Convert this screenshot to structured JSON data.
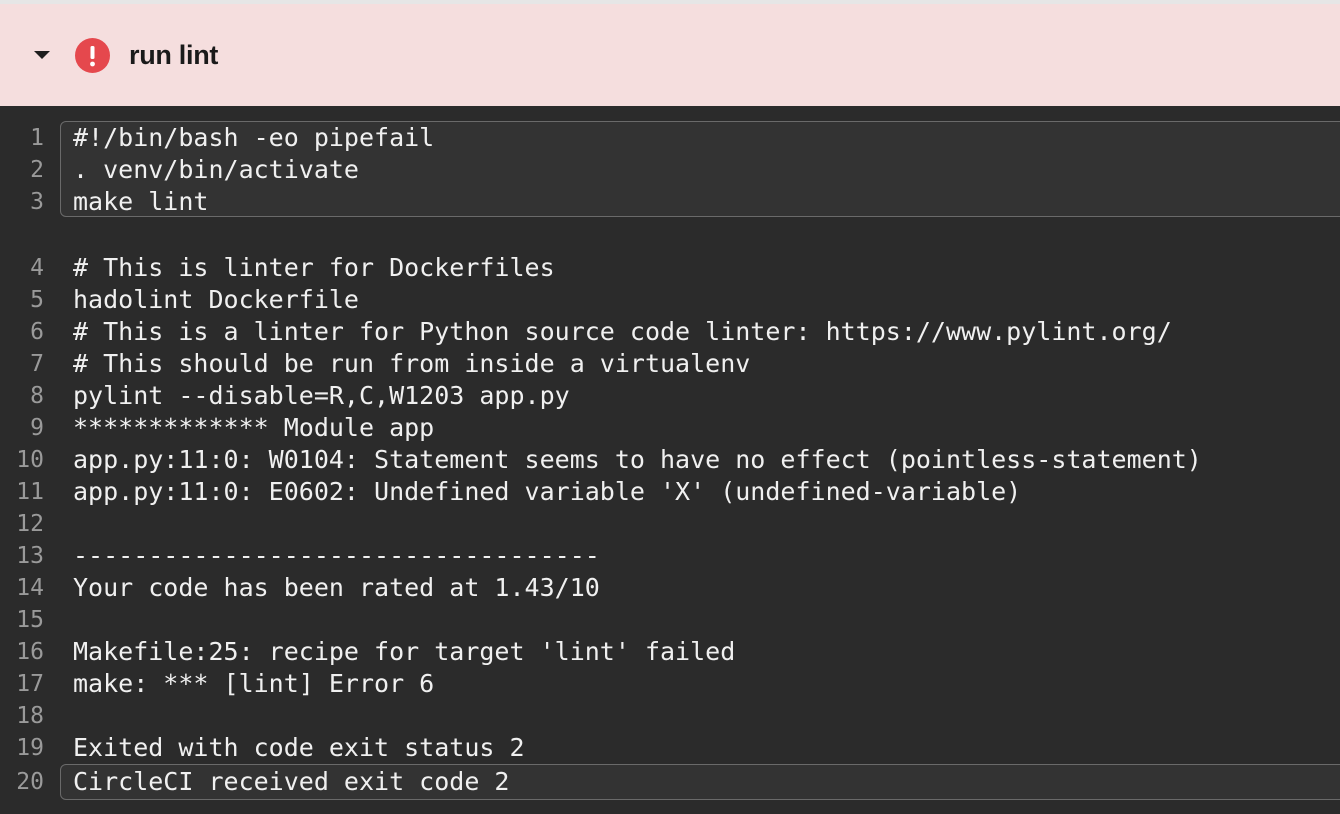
{
  "step": {
    "title": "run lint",
    "status": "failed",
    "status_color": "#e5484d",
    "header_bg": "#f5dede",
    "icons": {
      "toggle": "caret-down-icon",
      "status": "error-exclamation-icon"
    }
  },
  "output": {
    "lines": [
      {
        "n": "1",
        "text": "#!/bin/bash -eo pipefail"
      },
      {
        "n": "2",
        "text": ". venv/bin/activate"
      },
      {
        "n": "3",
        "text": "make lint"
      },
      {
        "n": "4",
        "text": "# This is linter for Dockerfiles"
      },
      {
        "n": "5",
        "text": "hadolint Dockerfile"
      },
      {
        "n": "6",
        "text": "# This is a linter for Python source code linter: https://www.pylint.org/"
      },
      {
        "n": "7",
        "text": "# This should be run from inside a virtualenv"
      },
      {
        "n": "8",
        "text": "pylint --disable=R,C,W1203 app.py"
      },
      {
        "n": "9",
        "text": "************* Module app"
      },
      {
        "n": "10",
        "text": "app.py:11:0: W0104: Statement seems to have no effect (pointless-statement)"
      },
      {
        "n": "11",
        "text": "app.py:11:0: E0602: Undefined variable 'X' (undefined-variable)"
      },
      {
        "n": "12",
        "text": ""
      },
      {
        "n": "13",
        "text": "-----------------------------------"
      },
      {
        "n": "14",
        "text": "Your code has been rated at 1.43/10"
      },
      {
        "n": "15",
        "text": ""
      },
      {
        "n": "16",
        "text": "Makefile:25: recipe for target 'lint' failed"
      },
      {
        "n": "17",
        "text": "make: *** [lint] Error 6"
      },
      {
        "n": "18",
        "text": ""
      },
      {
        "n": "19",
        "text": "Exited with code exit status 2"
      },
      {
        "n": "20",
        "text": "CircleCI received exit code 2"
      }
    ]
  }
}
